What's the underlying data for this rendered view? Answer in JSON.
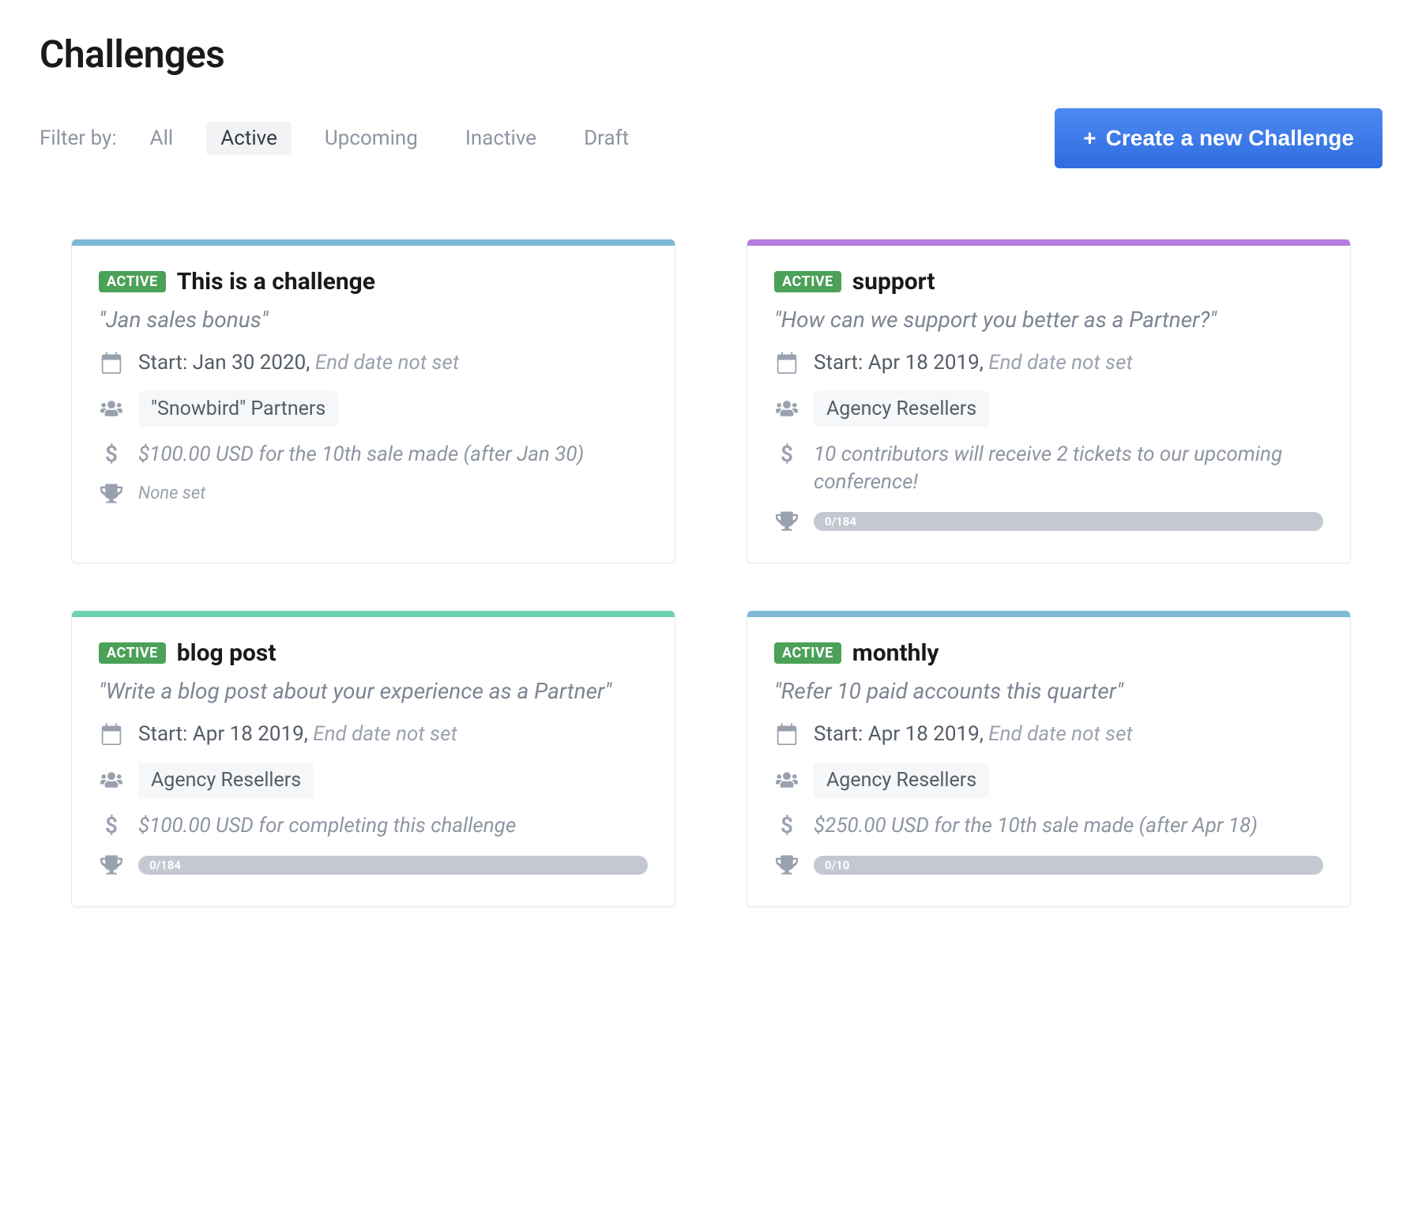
{
  "page": {
    "title": "Challenges"
  },
  "filter": {
    "label": "Filter by:",
    "items": [
      "All",
      "Active",
      "Upcoming",
      "Inactive",
      "Draft"
    ],
    "active_index": 1
  },
  "actions": {
    "create_label": "Create a new Challenge"
  },
  "cards": [
    {
      "stripe_color": "#7eb8d6",
      "status": "ACTIVE",
      "title": "This is a challenge",
      "subtitle": "\"Jan sales bonus\"",
      "start_label": "Start: Jan 30 2020,",
      "end_label": "End date not set",
      "group": "\"Snowbird\" Partners",
      "reward": "$100.00 USD for the 10th sale made (after Jan 30)",
      "trophy_type": "none",
      "trophy_none_label": "None set",
      "progress_label": ""
    },
    {
      "stripe_color": "#b47be0",
      "status": "ACTIVE",
      "title": "support",
      "subtitle": "\"How can we support you better as a Partner?\"",
      "start_label": "Start: Apr 18 2019,",
      "end_label": "End date not set",
      "group": "Agency Resellers",
      "reward": "10 contributors will receive 2 tickets to our upcoming conference!",
      "trophy_type": "progress",
      "trophy_none_label": "",
      "progress_label": "0/184"
    },
    {
      "stripe_color": "#6fd2b1",
      "status": "ACTIVE",
      "title": "blog post",
      "subtitle": "\"Write a blog post about your experience as a Partner\"",
      "start_label": "Start: Apr 18 2019,",
      "end_label": "End date not set",
      "group": "Agency Resellers",
      "reward": "$100.00 USD for completing this challenge",
      "trophy_type": "progress",
      "trophy_none_label": "",
      "progress_label": "0/184"
    },
    {
      "stripe_color": "#7eb8d6",
      "status": "ACTIVE",
      "title": "monthly",
      "subtitle": "\"Refer 10 paid accounts this quarter\"",
      "start_label": "Start: Apr 18 2019,",
      "end_label": "End date not set",
      "group": "Agency Resellers",
      "reward": "$250.00 USD for the 10th sale made (after Apr 18)",
      "trophy_type": "progress",
      "trophy_none_label": "",
      "progress_label": "0/10"
    }
  ]
}
